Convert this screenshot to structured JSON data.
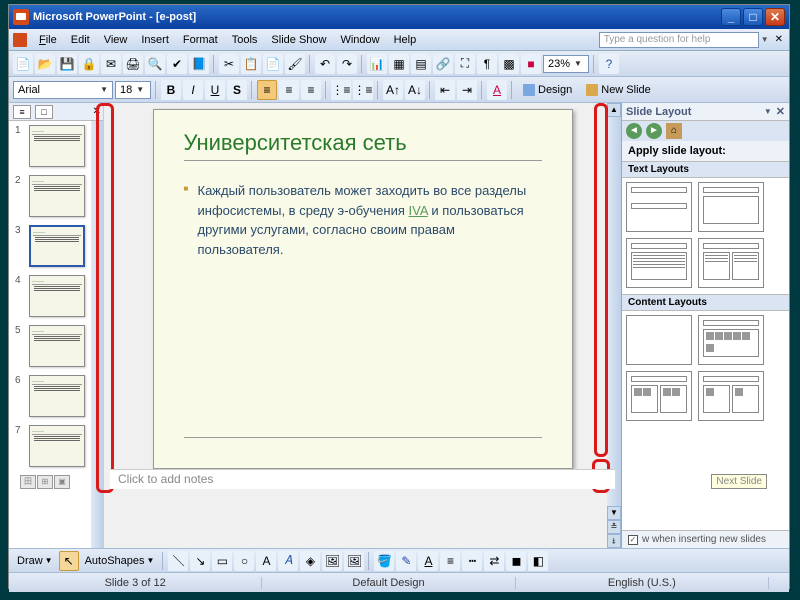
{
  "title": "Microsoft PowerPoint - [e-post]",
  "menu": {
    "file": "File",
    "edit": "Edit",
    "view": "View",
    "insert": "Insert",
    "format": "Format",
    "tools": "Tools",
    "slideshow": "Slide Show",
    "window": "Window",
    "help": "Help"
  },
  "help_placeholder": "Type a question for help",
  "zoom": "23%",
  "font": {
    "name": "Arial",
    "size": "18"
  },
  "toolbar": {
    "design": "Design",
    "newslide": "New Slide"
  },
  "slide": {
    "title": "Университетская сеть",
    "body": "Каждый пользователь может заходить во все разделы инфосистемы, в среду э-обучения ",
    "link": "IVA",
    "body2": " и пользоваться другими услугами, согласно своим правам пользователя."
  },
  "notes_placeholder": "Click to add notes",
  "thumbnails": [
    1,
    2,
    3,
    4,
    5,
    6,
    7
  ],
  "selected_thumb": 3,
  "taskpane": {
    "title": "Slide Layout",
    "apply": "Apply slide layout:",
    "text_layouts": "Text Layouts",
    "content_layouts": "Content Layouts",
    "show_inserting": "w when inserting new slides"
  },
  "tooltip": "Next Slide",
  "drawbar": {
    "draw": "Draw",
    "autoshapes": "AutoShapes"
  },
  "status": {
    "slide": "Slide 3 of 12",
    "design": "Default Design",
    "lang": "English (U.S.)"
  }
}
